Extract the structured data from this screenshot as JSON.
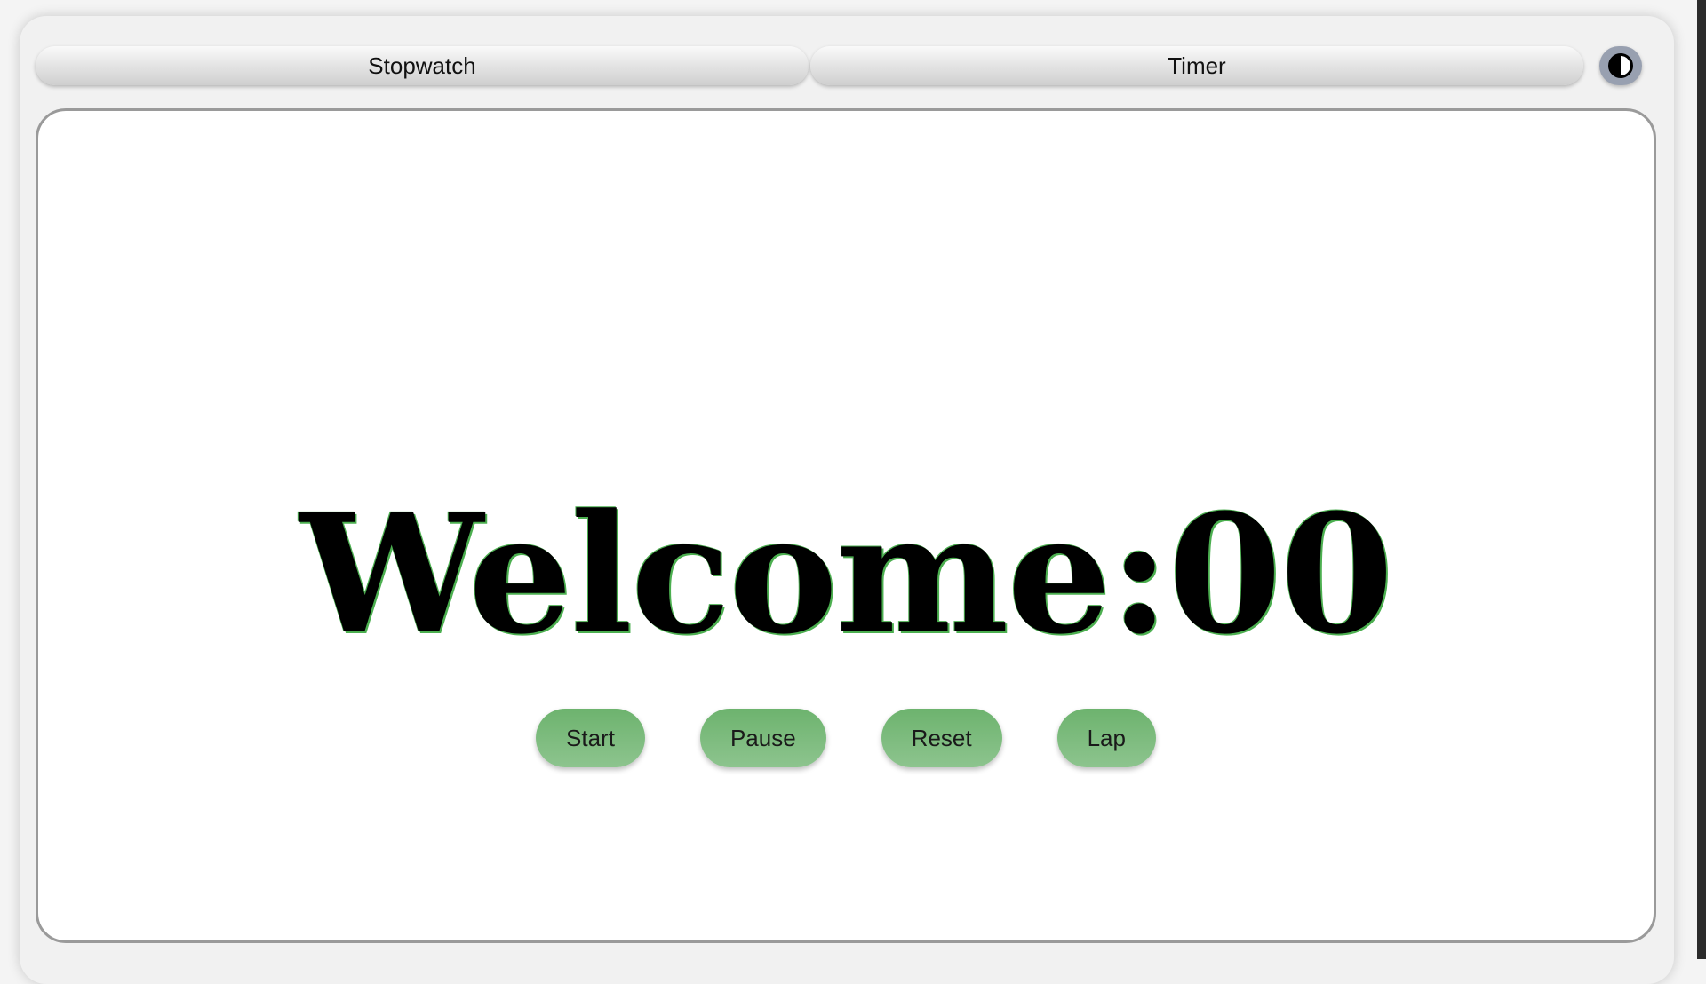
{
  "tabs": {
    "stopwatch_label": "Stopwatch",
    "timer_label": "Timer"
  },
  "theme_toggle": {
    "icon": "contrast-icon"
  },
  "display": {
    "text": "Welcome:00"
  },
  "controls": {
    "start_label": "Start",
    "pause_label": "Pause",
    "reset_label": "Reset",
    "lap_label": "Lap"
  },
  "colors": {
    "button_green": "#7dbb7e",
    "text_shadow_green": "#4caf50",
    "toggle_bg": "#98a0b0"
  }
}
